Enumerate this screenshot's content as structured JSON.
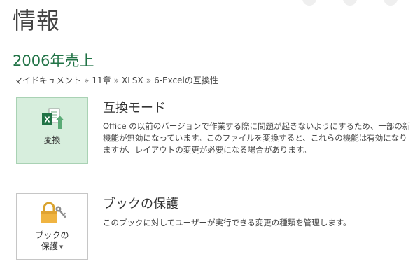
{
  "page": {
    "title": "情報"
  },
  "document": {
    "title": "2006年売上",
    "breadcrumb": [
      "マイドキュメント",
      "11章",
      "XLSX",
      "6-Excelの互換性"
    ],
    "breadcrumb_separator": "»"
  },
  "compatibility": {
    "button_label": "変換",
    "icon": "excel-convert-icon",
    "heading": "互換モード",
    "description": "Office の以前のバージョンで作業する際に問題が起きないようにするため、一部の新機能が無効になっています。このファイルを変換すると、これらの機能は有効になりますが、レイアウトの変更が必要になる場合があります。"
  },
  "protection": {
    "button_label_line1": "ブックの",
    "button_label_line2": "保護",
    "icon": "lock-key-icon",
    "heading": "ブックの保護",
    "description": "このブックに対してユーザーが実行できる変更の種類を管理します。"
  },
  "colors": {
    "accent": "#217346",
    "selected_bg": "#d7eedd",
    "lock": "#f0b441"
  }
}
